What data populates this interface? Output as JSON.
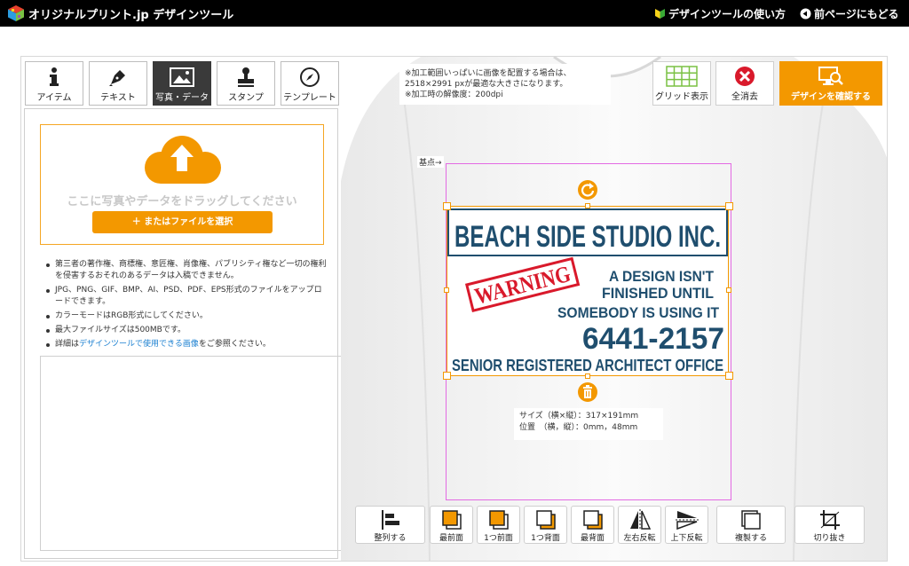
{
  "header": {
    "logo_text": "オリジナルプリント.jp デザインツール",
    "how_to": "デザインツールの使い方",
    "back": "前ページにもどる"
  },
  "tabs": [
    {
      "label": "アイテム",
      "icon": "info-icon"
    },
    {
      "label": "テキスト",
      "icon": "pen-icon"
    },
    {
      "label": "写真・データ",
      "icon": "image-icon",
      "active": true
    },
    {
      "label": "スタンプ",
      "icon": "stamp-icon"
    },
    {
      "label": "テンプレート",
      "icon": "compass-icon"
    }
  ],
  "upload": {
    "drop_text": "ここに写真やデータをドラッグしてください",
    "button_label": "＋ またはファイルを選択"
  },
  "notes": [
    "第三者の著作権、商標権、意匠権、肖像権、パブリシティ権など一切の権利を侵害するおそれのあるデータは入稿できません。",
    "JPG、PNG、GIF、BMP、AI、PSD、PDF、EPS形式のファイルをアップロードできます。",
    "カラーモードはRGB形式にしてください。",
    "最大ファイルサイズは500MBです。"
  ],
  "notes_detail": {
    "prefix": "詳細は",
    "link": "デザインツールで使用できる画像",
    "suffix": "をご参照ください。"
  },
  "info_note": {
    "line1": "※加工範囲いっぱいに画像を配置する場合は、",
    "line2": "2518×2991 pxが最適な大きさになります。",
    "line3": "※加工時の解像度：200dpi"
  },
  "toolbar": {
    "grid": "グリッド表示",
    "clear": "全消去",
    "confirm": "デザインを確認する"
  },
  "origin_label": "基点→",
  "print": {
    "line1": "BEACH SIDE STUDIO INC.",
    "warning": "WARNING",
    "line2": "A DESIGN ISN'T",
    "line3": "FINISHED UNTIL",
    "line4": "SOMEBODY IS USING IT",
    "phone": "6441-2157",
    "line5": "SENIOR REGISTERED ARCHITECT OFFICE"
  },
  "size_info": {
    "size_label": "サイズ（横×縦）：317×191mm",
    "pos_label": "位置　（横，縦）：0mm，48mm"
  },
  "bottom_tools": [
    {
      "label": "整列する",
      "icon": "align-icon"
    },
    {
      "label": "最前面",
      "icon": "bring-front-icon"
    },
    {
      "label": "1つ前面",
      "icon": "bring-forward-icon"
    },
    {
      "label": "1つ背面",
      "icon": "send-backward-icon"
    },
    {
      "label": "最背面",
      "icon": "send-back-icon"
    },
    {
      "label": "左右反転",
      "icon": "flip-h-icon"
    },
    {
      "label": "上下反転",
      "icon": "flip-v-icon"
    },
    {
      "label": "複製する",
      "icon": "duplicate-icon"
    },
    {
      "label": "切り抜き",
      "icon": "crop-icon"
    }
  ],
  "colors": {
    "accent": "#f39800",
    "ink": "#1f4e6e",
    "warning_red": "#d9192b",
    "design_area": "#e36ae3"
  }
}
